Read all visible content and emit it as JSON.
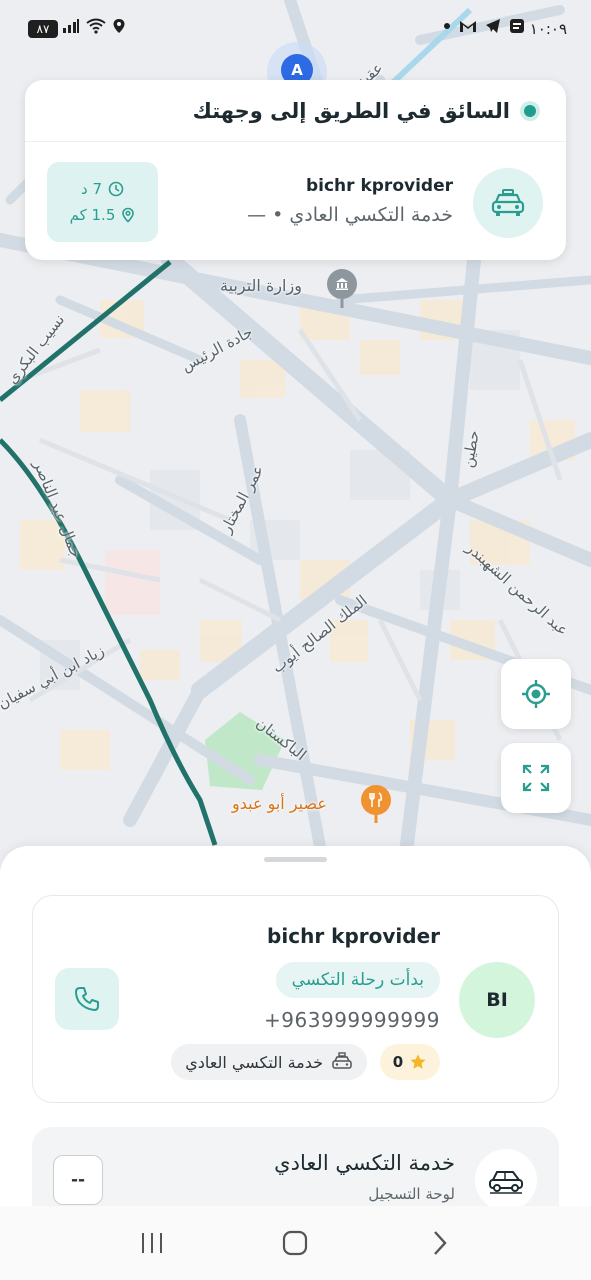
{
  "status_bar": {
    "time": "١٠:٠٩",
    "battery": "٨٧"
  },
  "map": {
    "labels": {
      "ministry": "وزارة التربية",
      "jadat_rais": "جادة الرئيس",
      "omar_mukhtar": "عمر المختار",
      "nasib_bakri": "نسيب البكري",
      "jamal_abdulnasser": "جمال عبد الناصر",
      "ziad": "زياد ابن أبي سفيان",
      "malik_saleh": "الملك الصالح أيوب",
      "pakistan": "الباكستان",
      "hittin": "حطين",
      "shahbandar": "عبد الرحمن الشهبندر",
      "juice_shop": "عصير أبو عبدو",
      "aqaba": "عقبة",
      "marker_letter": "A"
    }
  },
  "trip_card": {
    "status": "السائق في الطريق إلى وجهتك",
    "driver_name": "bichr kprovider",
    "service_line": "خدمة التكسي العادي • —",
    "eta_time": "7 د",
    "eta_distance": "1.5 كم"
  },
  "sheet": {
    "driver_name": "bichr kprovider",
    "trip_status": "بدأت رحلة التكسي",
    "phone": "+963999999999",
    "initials": "BI",
    "rating": "0",
    "service": "خدمة التكسي العادي",
    "vehicle_title": "خدمة التكسي العادي",
    "plate_label": "لوحة التسجيل",
    "plate_value": "--"
  },
  "colors": {
    "accent": "#2b9d8f",
    "accent_light": "#dff3f1",
    "avatar_green": "#d3f5dc",
    "rating_bg": "#fdf3dc",
    "poi_orange": "#f0922f"
  },
  "icons": [
    "battery-icon",
    "signal-icon",
    "wifi-icon",
    "location-icon",
    "taxi-icon",
    "clock-icon",
    "pin-icon",
    "locate-icon",
    "fullscreen-icon",
    "phone-icon",
    "star-icon",
    "car-icon",
    "recent-apps-icon",
    "home-icon",
    "back-icon"
  ]
}
